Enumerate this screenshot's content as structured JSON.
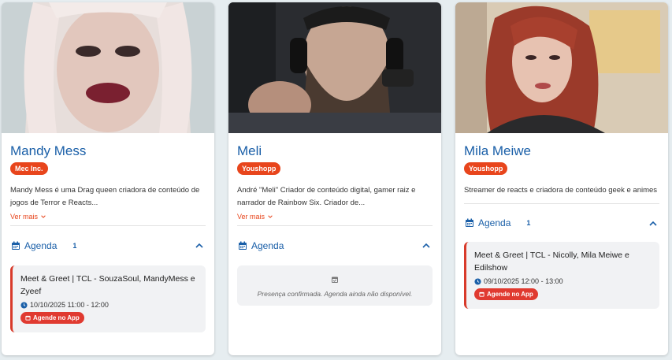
{
  "cards": [
    {
      "name": "Mandy Mess",
      "badge": "Mec Inc.",
      "description": "Mandy Mess é uma Drag queen criadora de conteúdo de jogos de Terror e Reacts...",
      "more_label": "Ver mais",
      "agenda_label": "Agenda",
      "agenda_count": "1",
      "event": {
        "title": "Meet & Greet | TCL - SouzaSoul, MandyMess e Zyeef",
        "time": "10/10/2025 11:00 - 12:00",
        "button_label": "Agende no App"
      }
    },
    {
      "name": "Meli",
      "badge": "Youshopp",
      "description": "André \"Meli\" Criador de conteúdo digital, gamer raiz e narrador de Rainbow Six. Criador de...",
      "more_label": "Ver mais",
      "agenda_label": "Agenda",
      "empty_message": "Presença confirmada. Agenda ainda não disponível."
    },
    {
      "name": "Mila Meiwe",
      "badge": "Youshopp",
      "description": "Streamer de reacts e criadora de conteúdo geek e animes",
      "agenda_label": "Agenda",
      "agenda_count": "1",
      "event": {
        "title": "Meet & Greet | TCL - Nicolly, Mila Meiwe e Edilshow",
        "time": "09/10/2025 12:00 - 13:00",
        "button_label": "Agende no App"
      }
    }
  ],
  "colors": {
    "accent_blue": "#1a5fa8",
    "badge_orange": "#e8451c",
    "event_red": "#d83a2a"
  },
  "icons": [
    "calendar-icon",
    "chevron-up-icon",
    "chevron-down-icon",
    "clock-icon",
    "calendar-check-icon"
  ]
}
